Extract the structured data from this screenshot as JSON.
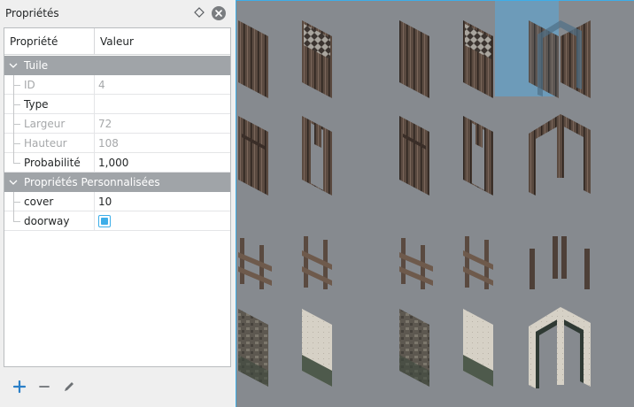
{
  "dock": {
    "title": "Propriétés",
    "float_icon": "diamond-icon",
    "close_icon": "close-icon"
  },
  "table": {
    "header": {
      "name": "Propriété",
      "value": "Valeur"
    },
    "groups": [
      {
        "label": "Tuile",
        "rows": [
          {
            "name": "ID",
            "value": "4",
            "enabled": false
          },
          {
            "name": "Type",
            "value": "",
            "enabled": true
          },
          {
            "name": "Largeur",
            "value": "72",
            "enabled": false
          },
          {
            "name": "Hauteur",
            "value": "108",
            "enabled": false
          },
          {
            "name": "Probabilité",
            "value": "1,000",
            "enabled": true
          }
        ]
      },
      {
        "label": "Propriétés Personnalisées",
        "rows": [
          {
            "name": "cover",
            "value": "10",
            "enabled": true
          },
          {
            "name": "doorway",
            "value": true,
            "enabled": true,
            "kind": "checkbox"
          }
        ]
      }
    ]
  },
  "toolbar": {
    "add_icon": "plus-icon",
    "remove_icon": "minus-icon",
    "rename_icon": "pencil-icon"
  },
  "tileset": {
    "background": "#868a8f",
    "selection_color": "#5aaadc",
    "rows": [
      [
        "plank-wall",
        "mesh-wall",
        "empty",
        "plank-wall",
        "mesh-wall",
        "arch-doorway"
      ],
      [
        "plank-door",
        "plank-door-open",
        "empty",
        "plank-door",
        "plank-door-open",
        "arch-doorway"
      ],
      [
        "fence",
        "fence-post",
        "empty",
        "fence",
        "fence-post",
        "posts"
      ],
      [
        "stone-wall",
        "plaster-wall",
        "empty",
        "stone-wall",
        "plaster-wall",
        "plaster-arch"
      ]
    ],
    "selected": {
      "row": 0,
      "col": 4
    }
  },
  "colors": {
    "accent": "#3daee9",
    "group_header": "#a0a4a8",
    "disabled_text": "#a6a8aa"
  }
}
